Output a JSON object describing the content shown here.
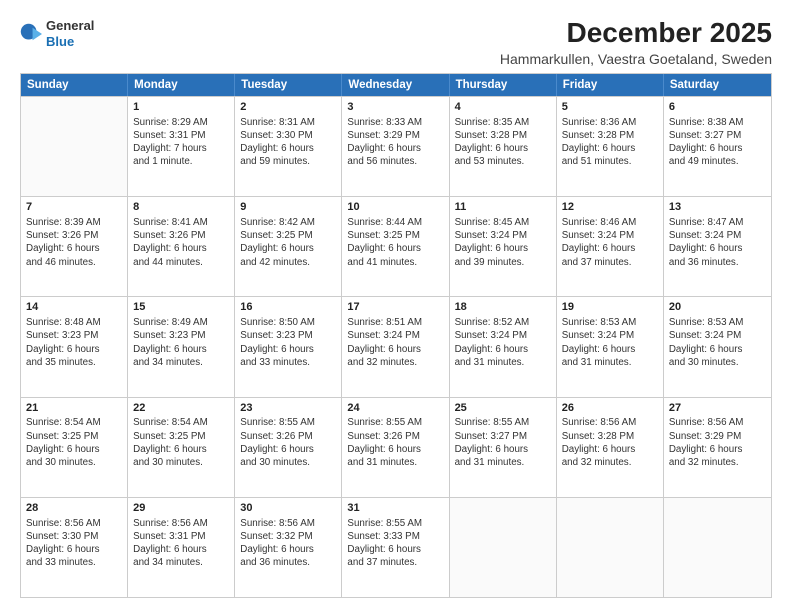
{
  "logo": {
    "general": "General",
    "blue": "Blue"
  },
  "title": "December 2025",
  "subtitle": "Hammarkullen, Vaestra Goetaland, Sweden",
  "header_days": [
    "Sunday",
    "Monday",
    "Tuesday",
    "Wednesday",
    "Thursday",
    "Friday",
    "Saturday"
  ],
  "weeks": [
    [
      {
        "day": "",
        "text": ""
      },
      {
        "day": "1",
        "text": "Sunrise: 8:29 AM\nSunset: 3:31 PM\nDaylight: 7 hours\nand 1 minute."
      },
      {
        "day": "2",
        "text": "Sunrise: 8:31 AM\nSunset: 3:30 PM\nDaylight: 6 hours\nand 59 minutes."
      },
      {
        "day": "3",
        "text": "Sunrise: 8:33 AM\nSunset: 3:29 PM\nDaylight: 6 hours\nand 56 minutes."
      },
      {
        "day": "4",
        "text": "Sunrise: 8:35 AM\nSunset: 3:28 PM\nDaylight: 6 hours\nand 53 minutes."
      },
      {
        "day": "5",
        "text": "Sunrise: 8:36 AM\nSunset: 3:28 PM\nDaylight: 6 hours\nand 51 minutes."
      },
      {
        "day": "6",
        "text": "Sunrise: 8:38 AM\nSunset: 3:27 PM\nDaylight: 6 hours\nand 49 minutes."
      }
    ],
    [
      {
        "day": "7",
        "text": "Sunrise: 8:39 AM\nSunset: 3:26 PM\nDaylight: 6 hours\nand 46 minutes."
      },
      {
        "day": "8",
        "text": "Sunrise: 8:41 AM\nSunset: 3:26 PM\nDaylight: 6 hours\nand 44 minutes."
      },
      {
        "day": "9",
        "text": "Sunrise: 8:42 AM\nSunset: 3:25 PM\nDaylight: 6 hours\nand 42 minutes."
      },
      {
        "day": "10",
        "text": "Sunrise: 8:44 AM\nSunset: 3:25 PM\nDaylight: 6 hours\nand 41 minutes."
      },
      {
        "day": "11",
        "text": "Sunrise: 8:45 AM\nSunset: 3:24 PM\nDaylight: 6 hours\nand 39 minutes."
      },
      {
        "day": "12",
        "text": "Sunrise: 8:46 AM\nSunset: 3:24 PM\nDaylight: 6 hours\nand 37 minutes."
      },
      {
        "day": "13",
        "text": "Sunrise: 8:47 AM\nSunset: 3:24 PM\nDaylight: 6 hours\nand 36 minutes."
      }
    ],
    [
      {
        "day": "14",
        "text": "Sunrise: 8:48 AM\nSunset: 3:23 PM\nDaylight: 6 hours\nand 35 minutes."
      },
      {
        "day": "15",
        "text": "Sunrise: 8:49 AM\nSunset: 3:23 PM\nDaylight: 6 hours\nand 34 minutes."
      },
      {
        "day": "16",
        "text": "Sunrise: 8:50 AM\nSunset: 3:23 PM\nDaylight: 6 hours\nand 33 minutes."
      },
      {
        "day": "17",
        "text": "Sunrise: 8:51 AM\nSunset: 3:24 PM\nDaylight: 6 hours\nand 32 minutes."
      },
      {
        "day": "18",
        "text": "Sunrise: 8:52 AM\nSunset: 3:24 PM\nDaylight: 6 hours\nand 31 minutes."
      },
      {
        "day": "19",
        "text": "Sunrise: 8:53 AM\nSunset: 3:24 PM\nDaylight: 6 hours\nand 31 minutes."
      },
      {
        "day": "20",
        "text": "Sunrise: 8:53 AM\nSunset: 3:24 PM\nDaylight: 6 hours\nand 30 minutes."
      }
    ],
    [
      {
        "day": "21",
        "text": "Sunrise: 8:54 AM\nSunset: 3:25 PM\nDaylight: 6 hours\nand 30 minutes."
      },
      {
        "day": "22",
        "text": "Sunrise: 8:54 AM\nSunset: 3:25 PM\nDaylight: 6 hours\nand 30 minutes."
      },
      {
        "day": "23",
        "text": "Sunrise: 8:55 AM\nSunset: 3:26 PM\nDaylight: 6 hours\nand 30 minutes."
      },
      {
        "day": "24",
        "text": "Sunrise: 8:55 AM\nSunset: 3:26 PM\nDaylight: 6 hours\nand 31 minutes."
      },
      {
        "day": "25",
        "text": "Sunrise: 8:55 AM\nSunset: 3:27 PM\nDaylight: 6 hours\nand 31 minutes."
      },
      {
        "day": "26",
        "text": "Sunrise: 8:56 AM\nSunset: 3:28 PM\nDaylight: 6 hours\nand 32 minutes."
      },
      {
        "day": "27",
        "text": "Sunrise: 8:56 AM\nSunset: 3:29 PM\nDaylight: 6 hours\nand 32 minutes."
      }
    ],
    [
      {
        "day": "28",
        "text": "Sunrise: 8:56 AM\nSunset: 3:30 PM\nDaylight: 6 hours\nand 33 minutes."
      },
      {
        "day": "29",
        "text": "Sunrise: 8:56 AM\nSunset: 3:31 PM\nDaylight: 6 hours\nand 34 minutes."
      },
      {
        "day": "30",
        "text": "Sunrise: 8:56 AM\nSunset: 3:32 PM\nDaylight: 6 hours\nand 36 minutes."
      },
      {
        "day": "31",
        "text": "Sunrise: 8:55 AM\nSunset: 3:33 PM\nDaylight: 6 hours\nand 37 minutes."
      },
      {
        "day": "",
        "text": ""
      },
      {
        "day": "",
        "text": ""
      },
      {
        "day": "",
        "text": ""
      }
    ]
  ]
}
